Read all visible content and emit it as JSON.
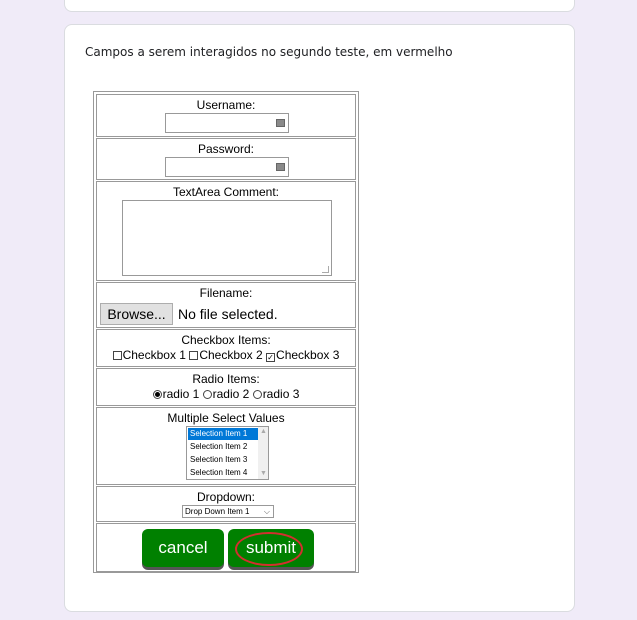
{
  "description": "Campos a serem interagidos no segundo teste, em vermelho",
  "form": {
    "username_label": "Username:",
    "password_label": "Password:",
    "textarea_label": "TextArea Comment:",
    "filename_label": "Filename:",
    "browse_label": "Browse...",
    "no_file_text": "No file selected.",
    "checkbox_label": "Checkbox Items:",
    "checkboxes": [
      {
        "label": "Checkbox 1",
        "checked": false
      },
      {
        "label": "Checkbox 2",
        "checked": false
      },
      {
        "label": "Checkbox 3",
        "checked": true
      }
    ],
    "radio_label": "Radio Items:",
    "radios": [
      {
        "label": "radio 1",
        "checked": true
      },
      {
        "label": "radio 2",
        "checked": false
      },
      {
        "label": "radio 3",
        "checked": false
      }
    ],
    "multiselect_label": "Multiple Select Values",
    "multiselect_options": [
      "Selection Item 1",
      "Selection Item 2",
      "Selection Item 3",
      "Selection Item 4"
    ],
    "multiselect_selected": "Selection Item 1",
    "dropdown_label": "Dropdown:",
    "dropdown_value": "Drop Down Item 1",
    "cancel_label": "cancel",
    "submit_label": "submit",
    "highlight_color": "#d32f2f",
    "button_color": "#008000"
  }
}
